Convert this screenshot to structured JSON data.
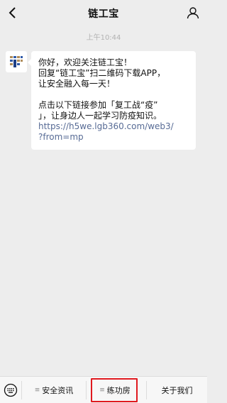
{
  "header": {
    "title": "链工宝",
    "back_icon": "chevron-left-icon",
    "profile_icon": "person-icon"
  },
  "chat": {
    "timestamp": "上午10:44",
    "message": {
      "lines": [
        "你好，欢迎关注链工宝！",
        "回复“链工宝”扫二维码下载APP，",
        "让安全融入每一天！"
      ],
      "lines2": [
        "点击以下链接参加「复工战“疫”",
        "」，让身边人一起学习防疫知识。"
      ],
      "link_lines": [
        "https://h5we.lgb360.com/web3/",
        "?from=mp"
      ]
    }
  },
  "menu": {
    "keyboard_icon": "keyboard-icon",
    "items": [
      {
        "label": "安全资讯",
        "has_submenu": true
      },
      {
        "label": "练功房",
        "has_submenu": true,
        "highlighted": true
      },
      {
        "label": "关于我们",
        "has_submenu": false
      }
    ]
  },
  "colors": {
    "background": "#ededed",
    "bubble": "#ffffff",
    "link": "#576b95",
    "highlight": "#e0191f"
  }
}
